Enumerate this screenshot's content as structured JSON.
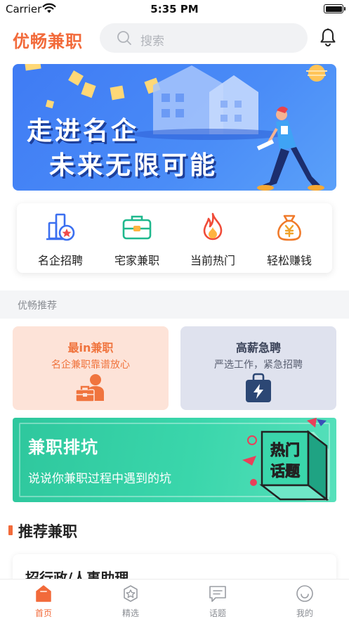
{
  "status_bar": {
    "carrier": "Carrier",
    "time": "5:35 PM"
  },
  "header": {
    "brand": "优畅兼职",
    "search_placeholder": "搜索"
  },
  "banner": {
    "line1": "走进名企",
    "line2": "未来无限可能"
  },
  "quick_links": [
    {
      "label": "名企招聘",
      "icon": "building-icon"
    },
    {
      "label": "宅家兼职",
      "icon": "briefcase-icon"
    },
    {
      "label": "当前热门",
      "icon": "fire-icon"
    },
    {
      "label": "轻松赚钱",
      "icon": "money-bag-icon"
    }
  ],
  "section": {
    "title": "优畅推荐"
  },
  "features": [
    {
      "title": "最in兼职",
      "subtitle": "名企兼职靠谱放心",
      "icon": "worker-icon"
    },
    {
      "title": "高薪急聘",
      "subtitle": "严选工作，紧急招聘",
      "icon": "power-bag-icon"
    }
  ],
  "topic": {
    "title": "兼职排坑",
    "subtitle": "说说你兼职过程中遇到的坑",
    "badge_line1": "热门",
    "badge_line2": "话题"
  },
  "recommend": {
    "title": "推荐兼职"
  },
  "job": {
    "title": "招行政/人事助理"
  },
  "tabs": [
    {
      "label": "首页",
      "icon": "home-icon",
      "active": true
    },
    {
      "label": "精选",
      "icon": "star-badge-icon",
      "active": false
    },
    {
      "label": "话题",
      "icon": "message-icon",
      "active": false
    },
    {
      "label": "我的",
      "icon": "smile-icon",
      "active": false
    }
  ],
  "colors": {
    "accent": "#f26a3a",
    "banner_blue": "#3f7bf4",
    "topic_green": "#2ec79d"
  }
}
